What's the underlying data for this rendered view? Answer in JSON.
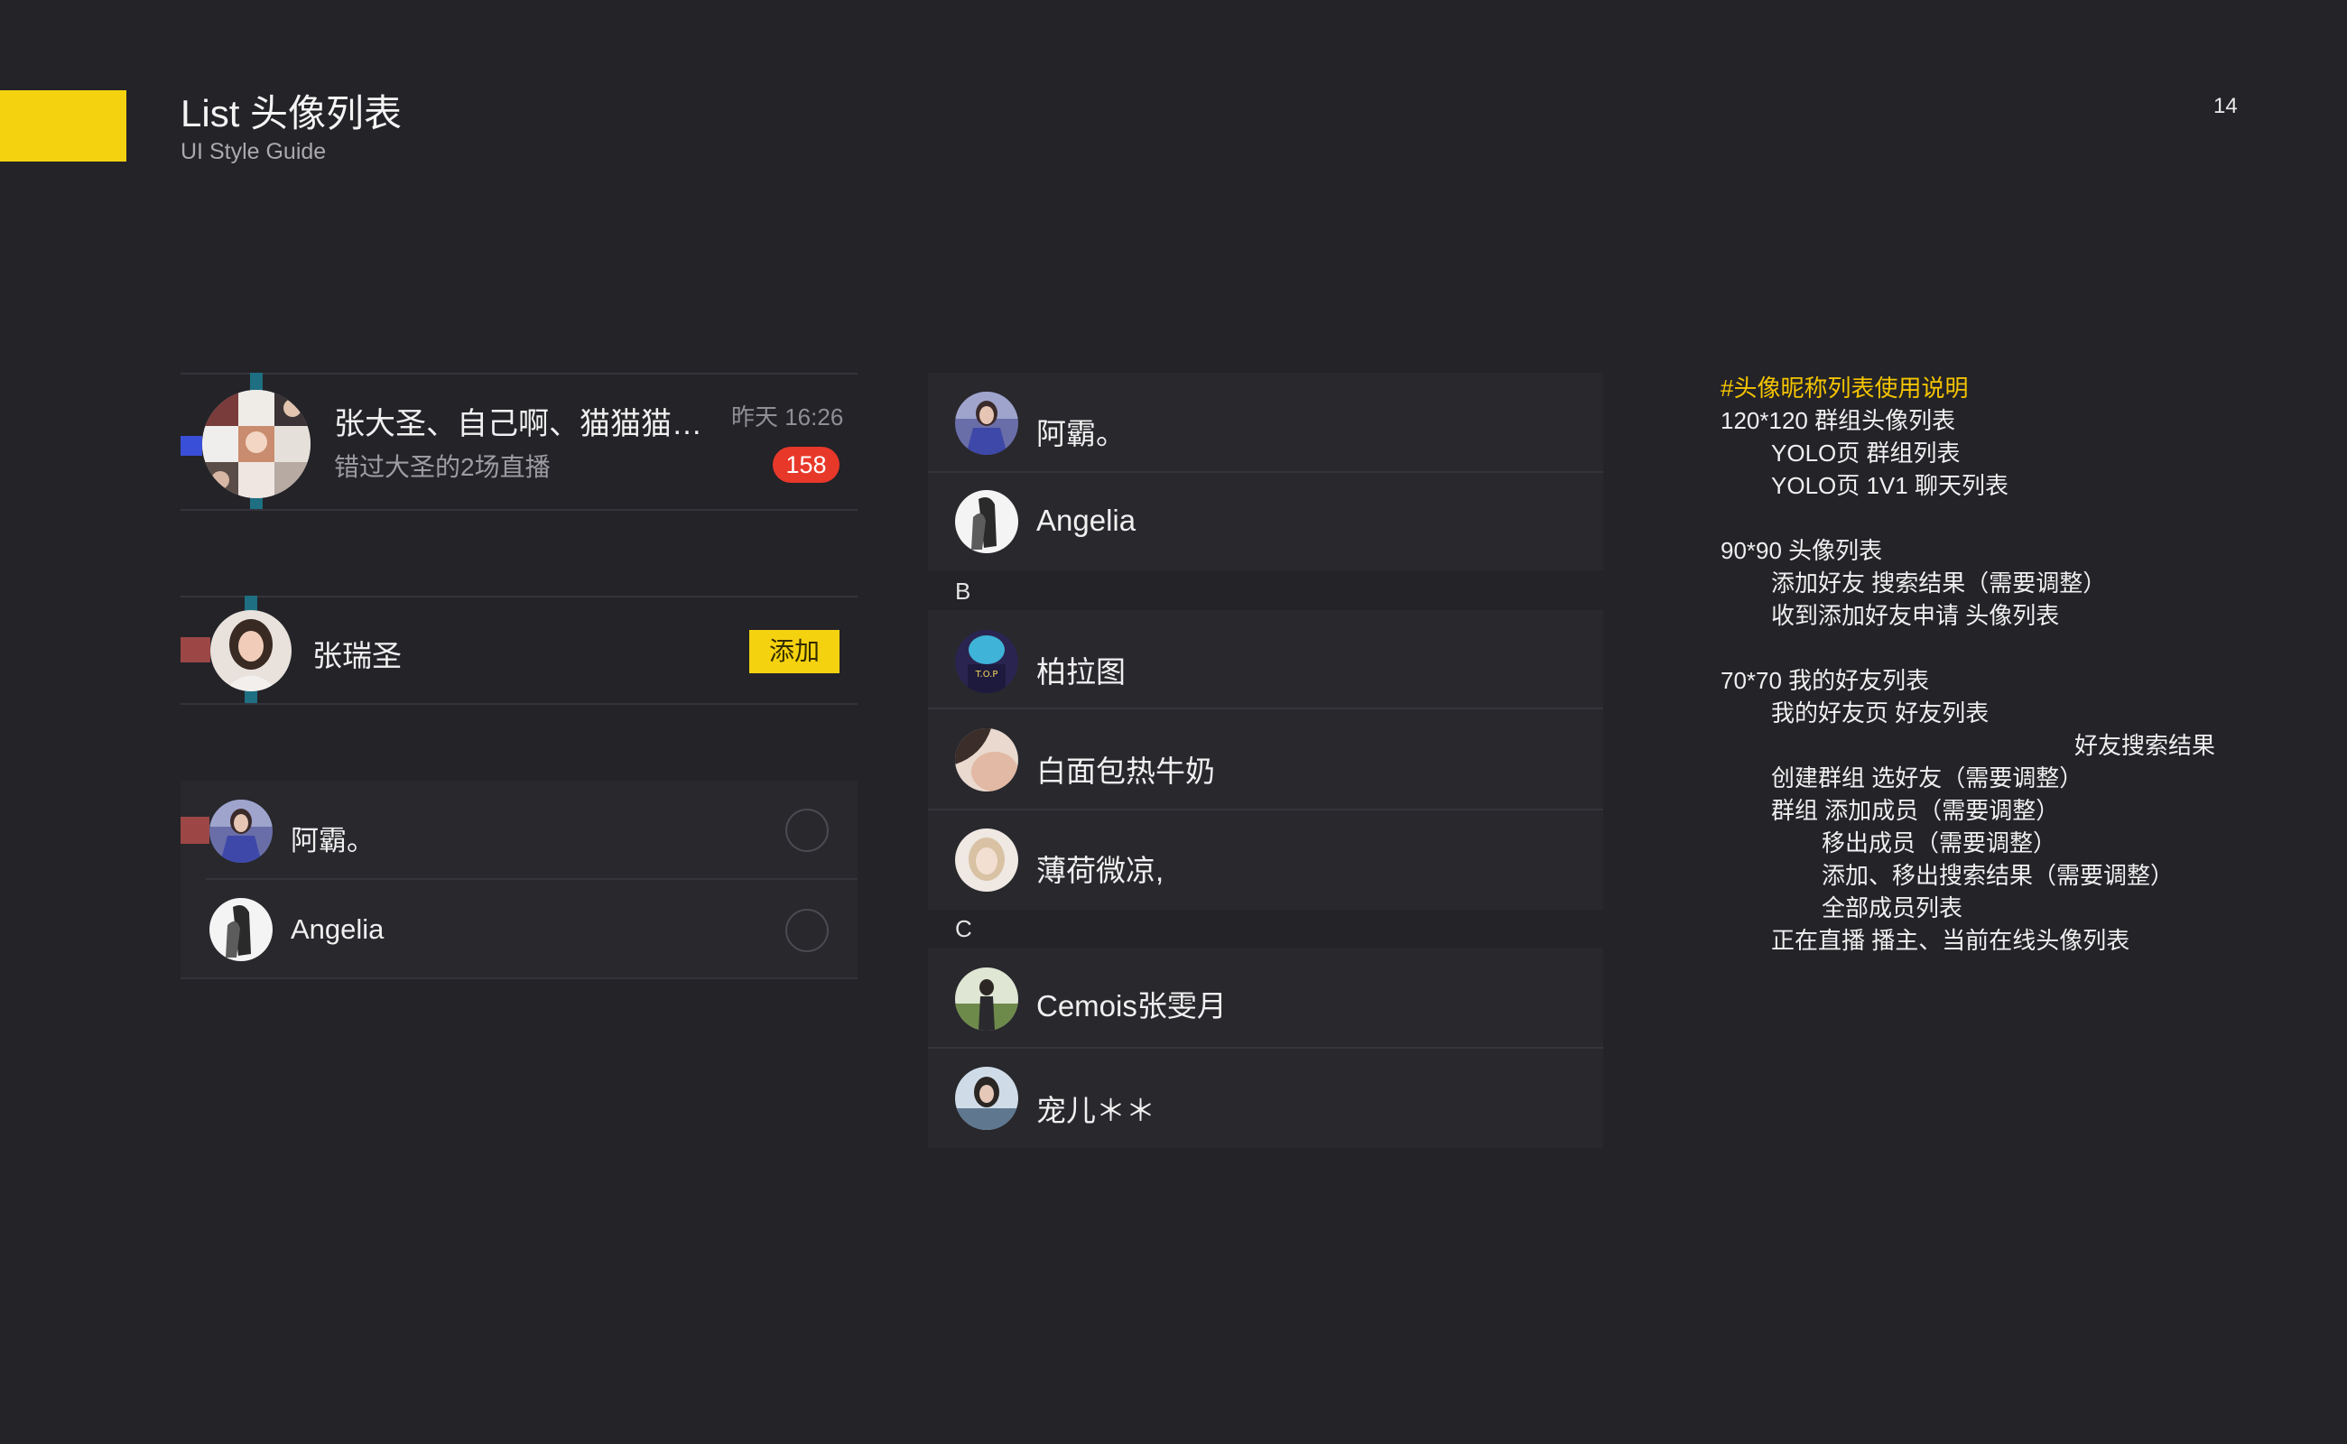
{
  "header": {
    "title": "List 头像列表",
    "subtitle": "UI Style Guide",
    "page_number": "14"
  },
  "group_chat": {
    "name": "张大圣、自己啊、猫猫猫…",
    "message": "错过大圣的2场直播",
    "time": "昨天 16:26",
    "unread_badge": "158"
  },
  "search_result": {
    "name": "张瑞圣",
    "add_label": "添加"
  },
  "select_list": {
    "items": [
      {
        "name": "阿霸。"
      },
      {
        "name": "Angelia"
      }
    ]
  },
  "friend_list": {
    "items": [
      {
        "name": "阿霸。"
      },
      {
        "name": "Angelia"
      }
    ],
    "sections": [
      {
        "letter": "B",
        "items": [
          {
            "name": "柏拉图"
          },
          {
            "name": "白面包热牛奶"
          },
          {
            "name": "薄荷微凉,"
          }
        ]
      },
      {
        "letter": "C",
        "items": [
          {
            "name": "Cemois张雯月"
          },
          {
            "name": "宠儿＊＊"
          }
        ]
      }
    ]
  },
  "notes": {
    "heading": "#头像昵称列表使用说明",
    "lines": [
      {
        "text": "120*120 群组头像列表",
        "indent": 0
      },
      {
        "text": "YOLO页 群组列表",
        "indent": 1
      },
      {
        "text": "YOLO页 1V1 聊天列表",
        "indent": 1
      },
      {
        "text": "",
        "indent": 0
      },
      {
        "text": "90*90 头像列表",
        "indent": 0
      },
      {
        "text": "添加好友 搜索结果（需要调整）",
        "indent": 1
      },
      {
        "text": "收到添加好友申请 头像列表",
        "indent": 1
      },
      {
        "text": "",
        "indent": 0
      },
      {
        "text": "70*70  我的好友列表",
        "indent": 0
      },
      {
        "text": "我的好友页 好友列表",
        "indent": 1
      },
      {
        "text": "好友搜索结果",
        "indent": 7
      },
      {
        "text": "创建群组 选好友（需要调整）",
        "indent": 1
      },
      {
        "text": "群组        添加成员（需要调整）",
        "indent": 1
      },
      {
        "text": "移出成员（需要调整）",
        "indent": 2
      },
      {
        "text": "添加、移出搜索结果（需要调整）",
        "indent": 2
      },
      {
        "text": "全部成员列表",
        "indent": 2
      },
      {
        "text": "正在直播  播主、当前在线头像列表",
        "indent": 1
      }
    ]
  },
  "colors": {
    "background": "#232328",
    "accent": "#f5d20f",
    "badge": "#e8382a",
    "note_heading": "#f5c400",
    "marker_blue": "#3a4fd8",
    "marker_teal": "#1e6f82",
    "marker_red": "#9c4646"
  }
}
